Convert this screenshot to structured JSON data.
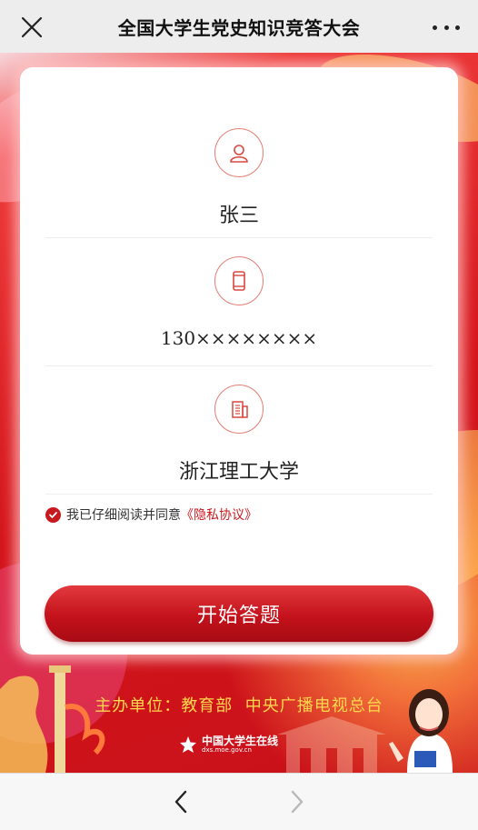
{
  "topbar": {
    "title": "全国大学生党史知识竞答大会",
    "close_icon": "close-icon",
    "more_icon": "more-dots-icon"
  },
  "form": {
    "name": {
      "icon": "user-icon",
      "value": "张三"
    },
    "phone": {
      "icon": "phone-icon",
      "value": "130××××××××"
    },
    "school": {
      "icon": "building-icon",
      "value": "浙江理工大学"
    }
  },
  "agreement": {
    "checked": true,
    "text": "我已仔细阅读并同意",
    "link": "《隐私协议》"
  },
  "start_button": {
    "label": "开始答题"
  },
  "footer": {
    "organizer_label": "主办单位：",
    "organizer_1": "教育部",
    "organizer_2": "中央广播电视总台",
    "logo_name": "中国大学生在线",
    "logo_url": "dxs.moe.gov.cn"
  },
  "nav": {
    "back_icon": "chevron-left-icon",
    "forward_icon": "chevron-right-icon"
  },
  "colors": {
    "brand_red": "#c8191f",
    "accent_gold": "#ffd84d",
    "icon_ring": "#e27d74"
  }
}
